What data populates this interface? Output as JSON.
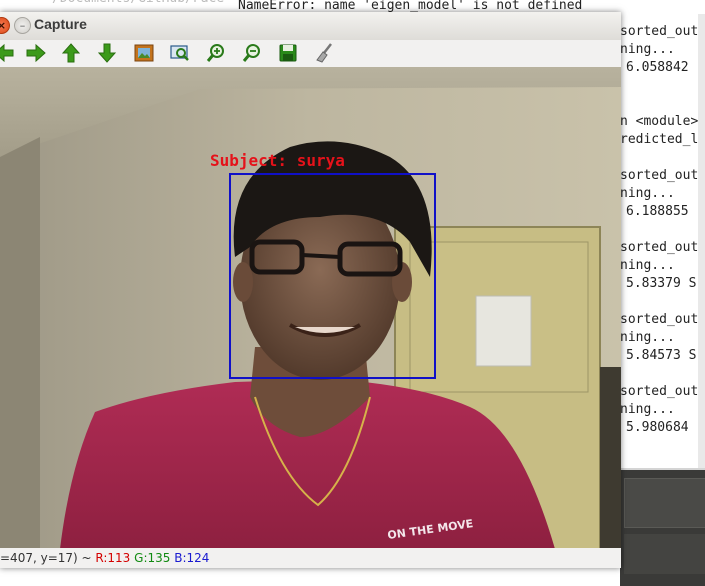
{
  "terminal": {
    "path_title": "/Documents/GitHub/Face",
    "lines": [
      {
        "text": "NameError: name 'eigen_model' is not defined",
        "row": 0
      },
      {
        "text": "sorted_out",
        "row": 1
      },
      {
        "text": "ning...",
        "row": 2
      },
      {
        "text": "6.058842",
        "row": 3
      },
      {
        "text": "n <module>",
        "row": 6
      },
      {
        "text": "redicted_l",
        "row": 7
      },
      {
        "text": "sorted_out",
        "row": 9
      },
      {
        "text": "ning...",
        "row": 10
      },
      {
        "text": "6.188855",
        "row": 11
      },
      {
        "text": "sorted_out",
        "row": 13
      },
      {
        "text": "ning...",
        "row": 14
      },
      {
        "text": "5.83379 S",
        "row": 15
      },
      {
        "text": "sorted_out",
        "row": 17
      },
      {
        "text": "ning...",
        "row": 18
      },
      {
        "text": "5.84573 S",
        "row": 19
      },
      {
        "text": "sorted_out",
        "row": 21
      },
      {
        "text": "ning...",
        "row": 22
      },
      {
        "text": "5.980684",
        "row": 23
      }
    ]
  },
  "window": {
    "title": "Capture",
    "close_glyph": "×",
    "minimize_glyph": "–"
  },
  "toolbar": {
    "buttons": [
      {
        "name": "back-arrow",
        "icon": "arrow-left-icon",
        "color": "#3c9a1a"
      },
      {
        "name": "forward-arrow",
        "icon": "arrow-right-icon",
        "color": "#3c9a1a"
      },
      {
        "name": "up-arrow",
        "icon": "arrow-up-icon",
        "color": "#3c9a1a"
      },
      {
        "name": "down-arrow",
        "icon": "arrow-down-icon",
        "color": "#3c9a1a"
      },
      {
        "name": "image-button",
        "icon": "image-icon",
        "color": "#c4731c"
      },
      {
        "name": "zoom-fit-button",
        "icon": "zoom-fit-icon",
        "color": "#2a7a1a"
      },
      {
        "name": "zoom-in-button",
        "icon": "zoom-in-icon",
        "color": "#2a7a1a"
      },
      {
        "name": "zoom-out-button",
        "icon": "zoom-out-icon",
        "color": "#2a7a1a"
      },
      {
        "name": "save-button",
        "icon": "save-icon",
        "color": "#2a8a1a"
      },
      {
        "name": "clear-button",
        "icon": "broom-icon",
        "color": "#888888"
      }
    ]
  },
  "overlay": {
    "label": "Subject: surya",
    "label_color": "#e5121a",
    "box_color": "#1010c8"
  },
  "statusbar": {
    "coords": "=407, y=17) ~ ",
    "r": "R:113",
    "g": "G:135",
    "b": "B:124"
  }
}
